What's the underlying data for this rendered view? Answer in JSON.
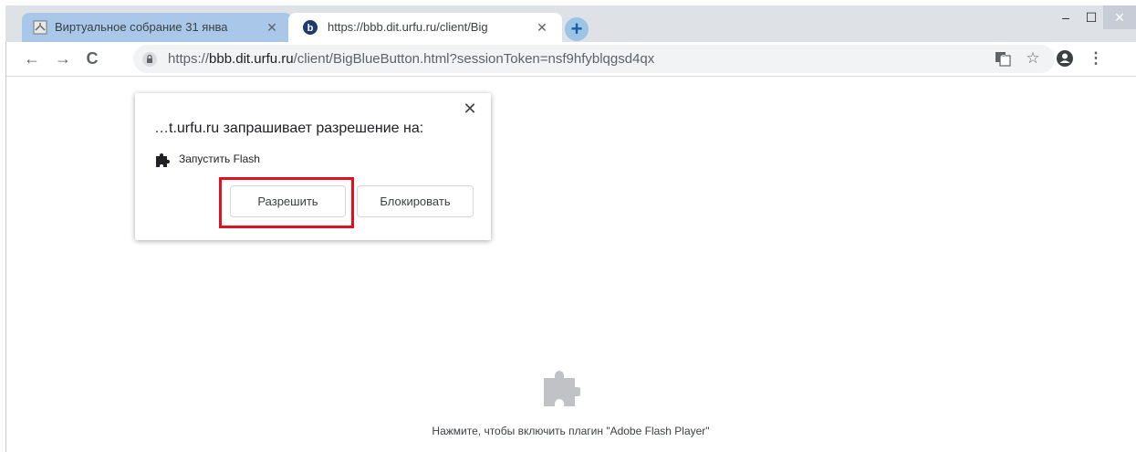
{
  "browser": {
    "tabs": [
      {
        "title": "Виртуальное собрание 31 янва",
        "close_glyph": "✕",
        "favicon": "document-icon",
        "active": false
      },
      {
        "title": "https://bbb.dit.urfu.ru/client/Big",
        "close_glyph": "✕",
        "favicon": "bigbluebutton-icon",
        "active": true
      }
    ],
    "new_tab_glyph": "+",
    "window_controls": {
      "minimize": "‒",
      "maximize": "☐",
      "close": "✕"
    },
    "nav": {
      "back": "←",
      "forward": "→",
      "reload": "C"
    },
    "url": {
      "scheme": "https://",
      "host": "bbb.dit.urfu.ru",
      "path": "/client/BigBlueButton.html?sessionToken=nsf9hfyblqgsd4qx"
    },
    "toolbar_icons": {
      "translate": "translate-icon",
      "bookmark": "☆",
      "profile": "account-icon",
      "menu": "⋮"
    }
  },
  "permission_popup": {
    "message": "…t.urfu.ru запрашивает разрешение на:",
    "close_glyph": "✕",
    "permission_label": "Запустить Flash",
    "allow_label": "Разрешить",
    "block_label": "Блокировать"
  },
  "page": {
    "plugin_prompt": "Нажмите, чтобы включить плагин \"Adobe Flash Player\""
  },
  "colors": {
    "highlight": "#e3101d",
    "tabstrip": "#dee1e6",
    "inactive_tab": "#a9c7e8"
  }
}
